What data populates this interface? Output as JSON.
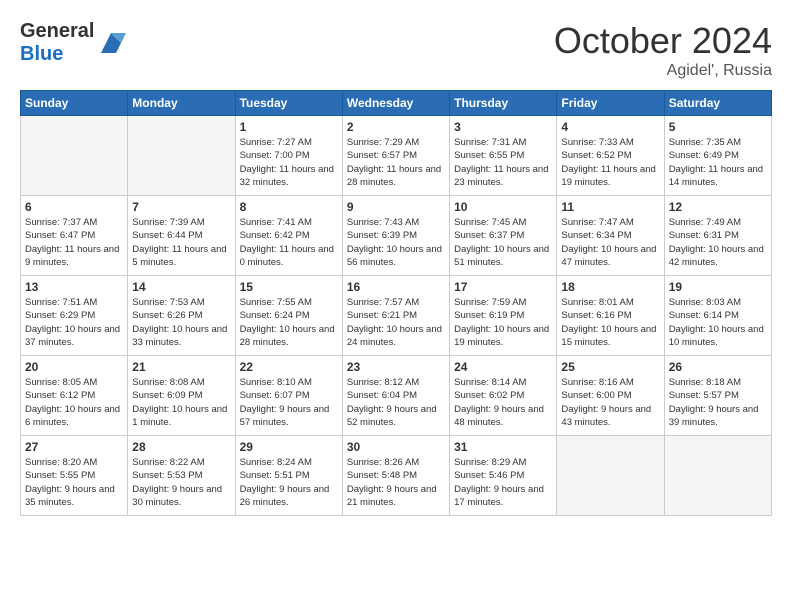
{
  "header": {
    "logo_general": "General",
    "logo_blue": "Blue",
    "month": "October 2024",
    "location": "Agidel', Russia"
  },
  "weekdays": [
    "Sunday",
    "Monday",
    "Tuesday",
    "Wednesday",
    "Thursday",
    "Friday",
    "Saturday"
  ],
  "weeks": [
    [
      {
        "day": "",
        "empty": true
      },
      {
        "day": "",
        "empty": true
      },
      {
        "day": "1",
        "sunrise": "7:27 AM",
        "sunset": "7:00 PM",
        "daylight": "Daylight: 11 hours and 32 minutes."
      },
      {
        "day": "2",
        "sunrise": "7:29 AM",
        "sunset": "6:57 PM",
        "daylight": "Daylight: 11 hours and 28 minutes."
      },
      {
        "day": "3",
        "sunrise": "7:31 AM",
        "sunset": "6:55 PM",
        "daylight": "Daylight: 11 hours and 23 minutes."
      },
      {
        "day": "4",
        "sunrise": "7:33 AM",
        "sunset": "6:52 PM",
        "daylight": "Daylight: 11 hours and 19 minutes."
      },
      {
        "day": "5",
        "sunrise": "7:35 AM",
        "sunset": "6:49 PM",
        "daylight": "Daylight: 11 hours and 14 minutes."
      }
    ],
    [
      {
        "day": "6",
        "sunrise": "7:37 AM",
        "sunset": "6:47 PM",
        "daylight": "Daylight: 11 hours and 9 minutes."
      },
      {
        "day": "7",
        "sunrise": "7:39 AM",
        "sunset": "6:44 PM",
        "daylight": "Daylight: 11 hours and 5 minutes."
      },
      {
        "day": "8",
        "sunrise": "7:41 AM",
        "sunset": "6:42 PM",
        "daylight": "Daylight: 11 hours and 0 minutes."
      },
      {
        "day": "9",
        "sunrise": "7:43 AM",
        "sunset": "6:39 PM",
        "daylight": "Daylight: 10 hours and 56 minutes."
      },
      {
        "day": "10",
        "sunrise": "7:45 AM",
        "sunset": "6:37 PM",
        "daylight": "Daylight: 10 hours and 51 minutes."
      },
      {
        "day": "11",
        "sunrise": "7:47 AM",
        "sunset": "6:34 PM",
        "daylight": "Daylight: 10 hours and 47 minutes."
      },
      {
        "day": "12",
        "sunrise": "7:49 AM",
        "sunset": "6:31 PM",
        "daylight": "Daylight: 10 hours and 42 minutes."
      }
    ],
    [
      {
        "day": "13",
        "sunrise": "7:51 AM",
        "sunset": "6:29 PM",
        "daylight": "Daylight: 10 hours and 37 minutes."
      },
      {
        "day": "14",
        "sunrise": "7:53 AM",
        "sunset": "6:26 PM",
        "daylight": "Daylight: 10 hours and 33 minutes."
      },
      {
        "day": "15",
        "sunrise": "7:55 AM",
        "sunset": "6:24 PM",
        "daylight": "Daylight: 10 hours and 28 minutes."
      },
      {
        "day": "16",
        "sunrise": "7:57 AM",
        "sunset": "6:21 PM",
        "daylight": "Daylight: 10 hours and 24 minutes."
      },
      {
        "day": "17",
        "sunrise": "7:59 AM",
        "sunset": "6:19 PM",
        "daylight": "Daylight: 10 hours and 19 minutes."
      },
      {
        "day": "18",
        "sunrise": "8:01 AM",
        "sunset": "6:16 PM",
        "daylight": "Daylight: 10 hours and 15 minutes."
      },
      {
        "day": "19",
        "sunrise": "8:03 AM",
        "sunset": "6:14 PM",
        "daylight": "Daylight: 10 hours and 10 minutes."
      }
    ],
    [
      {
        "day": "20",
        "sunrise": "8:05 AM",
        "sunset": "6:12 PM",
        "daylight": "Daylight: 10 hours and 6 minutes."
      },
      {
        "day": "21",
        "sunrise": "8:08 AM",
        "sunset": "6:09 PM",
        "daylight": "Daylight: 10 hours and 1 minute."
      },
      {
        "day": "22",
        "sunrise": "8:10 AM",
        "sunset": "6:07 PM",
        "daylight": "Daylight: 9 hours and 57 minutes."
      },
      {
        "day": "23",
        "sunrise": "8:12 AM",
        "sunset": "6:04 PM",
        "daylight": "Daylight: 9 hours and 52 minutes."
      },
      {
        "day": "24",
        "sunrise": "8:14 AM",
        "sunset": "6:02 PM",
        "daylight": "Daylight: 9 hours and 48 minutes."
      },
      {
        "day": "25",
        "sunrise": "8:16 AM",
        "sunset": "6:00 PM",
        "daylight": "Daylight: 9 hours and 43 minutes."
      },
      {
        "day": "26",
        "sunrise": "8:18 AM",
        "sunset": "5:57 PM",
        "daylight": "Daylight: 9 hours and 39 minutes."
      }
    ],
    [
      {
        "day": "27",
        "sunrise": "8:20 AM",
        "sunset": "5:55 PM",
        "daylight": "Daylight: 9 hours and 35 minutes."
      },
      {
        "day": "28",
        "sunrise": "8:22 AM",
        "sunset": "5:53 PM",
        "daylight": "Daylight: 9 hours and 30 minutes."
      },
      {
        "day": "29",
        "sunrise": "8:24 AM",
        "sunset": "5:51 PM",
        "daylight": "Daylight: 9 hours and 26 minutes."
      },
      {
        "day": "30",
        "sunrise": "8:26 AM",
        "sunset": "5:48 PM",
        "daylight": "Daylight: 9 hours and 21 minutes."
      },
      {
        "day": "31",
        "sunrise": "8:29 AM",
        "sunset": "5:46 PM",
        "daylight": "Daylight: 9 hours and 17 minutes."
      },
      {
        "day": "",
        "empty": true
      },
      {
        "day": "",
        "empty": true
      }
    ]
  ]
}
